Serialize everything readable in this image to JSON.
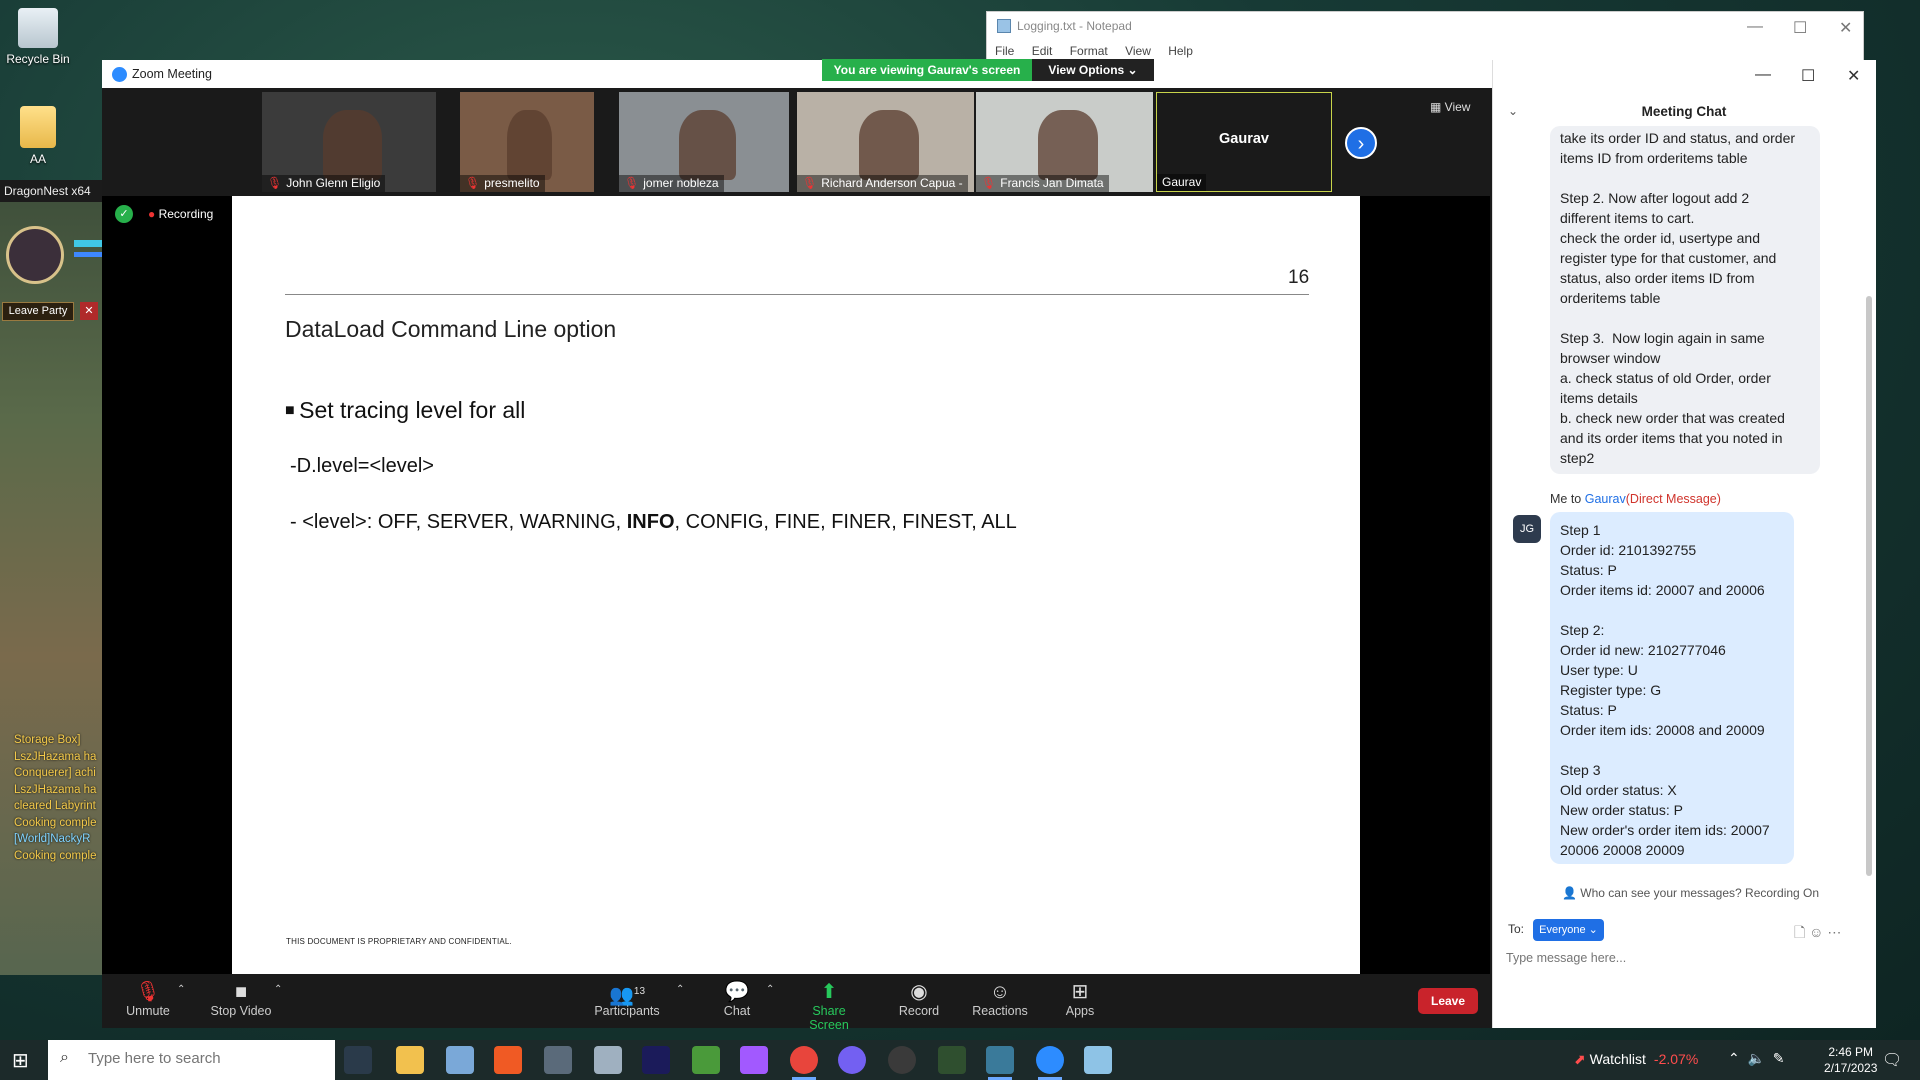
{
  "desktop": {
    "icons": [
      {
        "label": "Recycle Bin"
      },
      {
        "label": "AA"
      }
    ]
  },
  "game": {
    "title": "DragonNest x64",
    "leave_party": "Leave Party",
    "chat_log": [
      {
        "text": "Storage Box]",
        "color": "#f3c94a"
      },
      {
        "text": "LszJHazama ha",
        "color": "#f3c94a"
      },
      {
        "text": "Conquerer] achi",
        "color": "#f3c94a"
      },
      {
        "text": "LszJHazama ha",
        "color": "#f3c94a"
      },
      {
        "text": "cleared Labyrint",
        "color": "#f3c94a"
      },
      {
        "text": "Cooking comple",
        "color": "#f3c94a"
      },
      {
        "text": "[World]NackyR",
        "color": "#7fd3ff"
      },
      {
        "text": "Cooking comple",
        "color": "#f3c94a"
      }
    ]
  },
  "notepad": {
    "title": "Logging.txt - Notepad",
    "menu": [
      "File",
      "Edit",
      "Format",
      "View",
      "Help"
    ]
  },
  "zoom": {
    "window_title": "Zoom Meeting",
    "viewing_banner": "You are viewing Gaurav's screen",
    "view_options": "View Options ⌄",
    "view_button": "View",
    "recording": "Recording",
    "participants": [
      {
        "name": "John Glenn Eligio",
        "bg": "#3b3b3b"
      },
      {
        "name": "presmelito",
        "bg": "#7a5b46"
      },
      {
        "name": "jomer nobleza",
        "bg": "#8a8f93"
      },
      {
        "name": "Richard Anderson Capua -",
        "bg": "#b9b1a6"
      },
      {
        "name": "Francis Jan Dimata",
        "bg": "#c9ccc9"
      },
      {
        "name": "Gaurav",
        "bg": "#1a1a1a",
        "big": "Gaurav"
      }
    ],
    "slide": {
      "page_number": "16",
      "title": "DataLoad Command Line option",
      "bullet": "Set tracing level for all",
      "line1": "-D.level=<level>",
      "line2_pre": "- <level>: OFF, SERVER, WARNING, ",
      "line2_bold": "INFO",
      "line2_post": ", CONFIG, FINE, FINER, FINEST, ALL",
      "footer": "THIS DOCUMENT IS PROPRIETARY AND CONFIDENTIAL."
    },
    "toolbar": {
      "unmute": "Unmute",
      "stop_video": "Stop Video",
      "participants": "Participants",
      "participants_count": "13",
      "chat": "Chat",
      "share_screen": "Share Screen",
      "record": "Record",
      "reactions": "Reactions",
      "apps": "Apps",
      "leave": "Leave"
    }
  },
  "chat": {
    "title": "Meeting Chat",
    "received_message": "take its order ID and status, and order\nitems ID from orderitems table\n\nStep 2. Now after logout add 2\ndifferent items to cart.\ncheck the order id, usertype and\nregister type for that customer, and\nstatus, also order items ID from\norderitems table\n\nStep 3.  Now login again in same\nbrowser window\na. check status of old Order, order\nitems details\nb. check new order that was created\nand its order items that you noted in\nstep2",
    "dm_prefix": "Me to ",
    "dm_to": "Gaurav",
    "dm_tag": "(Direct Message)",
    "avatar": "JG",
    "my_message": "Step 1\nOrder id: 2101392755\nStatus: P\nOrder items id: 20007 and 20006\n\nStep 2:\nOrder id new: 2102777046\nUser type: U\nRegister type: G\nStatus: P\nOrder item ids: 20008 and 20009\n\nStep 3\nOld order status: X\nNew order status: P\nNew order's order item ids: 20007\n20006 20008 20009",
    "who_can_see": "Who can see your messages? Recording On",
    "to_label": "To:",
    "to_value": "Everyone ⌄",
    "input_placeholder": "Type message here..."
  },
  "taskbar": {
    "search_placeholder": "Type here to search",
    "watchlist": "Watchlist",
    "watchlist_change": "-2.07%",
    "time": "2:46 PM",
    "date": "2/17/2023"
  }
}
